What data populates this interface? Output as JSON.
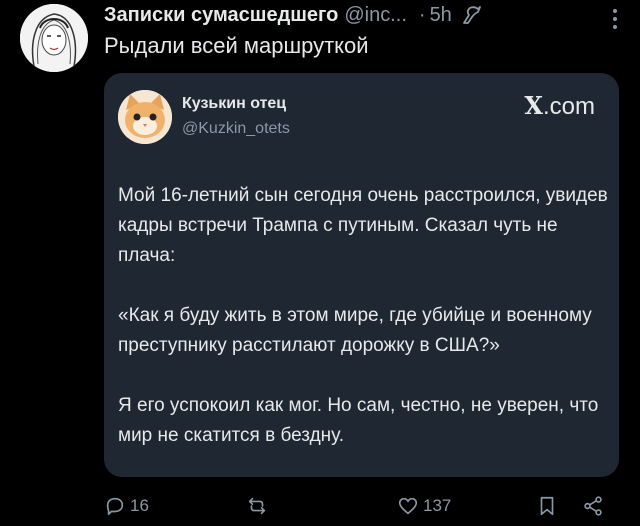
{
  "tweet": {
    "author_name": "Записки сумасшедшего",
    "handle": "@inc...",
    "separator": "·",
    "time": "5h",
    "text": "Рыдали всей маршруткой"
  },
  "quoted": {
    "author_name": "Кузькин отец",
    "handle": "@Kuzkin_otets",
    "source": ".com",
    "source_x": "X",
    "paragraphs": [
      "Мой 16-летний сын сегодня очень расстроился, увидев кадры встречи Трампа с путиным. Сказал чуть не плача:",
      "«Как я буду жить в этом мире, где убийце и военному преступнику расстилают дорожку в США?»",
      "Я его успокоил как мог. Но сам, честно, не уверен, что мир не скатится в бездну."
    ]
  },
  "actions": {
    "replies": "16",
    "likes": "137"
  },
  "colors": {
    "background": "#000000",
    "card": "#1e2732",
    "text": "#e7e9ea",
    "muted": "#8b98a5"
  }
}
